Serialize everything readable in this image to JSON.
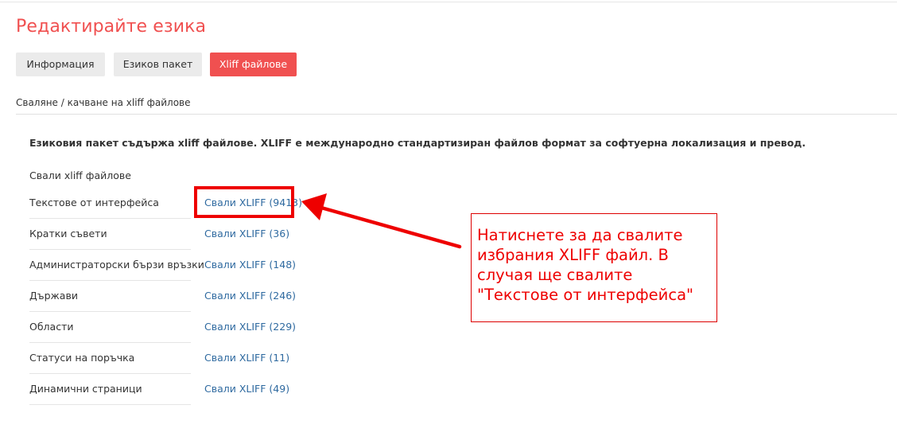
{
  "page": {
    "title": "Редактирайте езика"
  },
  "tabs": [
    {
      "label": "Информация",
      "active": false
    },
    {
      "label": "Езиков пакет",
      "active": false
    },
    {
      "label": "Xliff файлове",
      "active": true
    }
  ],
  "section": {
    "caption": "Сваляне / качване на xliff файлове"
  },
  "intro": "Езиковия пакет съдържа xliff файлове. XLIFF е международно стандартизиран файлов формат за софтуерна локализация и превод.",
  "table": {
    "header": "Свали xliff файлове",
    "rows": [
      {
        "label": "Текстове от интерфейса",
        "link": "Свали XLIFF (9413)"
      },
      {
        "label": "Кратки съвети",
        "link": "Свали XLIFF (36)"
      },
      {
        "label": "Администраторски бързи връзки",
        "link": "Свали XLIFF (148)"
      },
      {
        "label": "Държави",
        "link": "Свали XLIFF (246)"
      },
      {
        "label": "Области",
        "link": "Свали XLIFF (229)"
      },
      {
        "label": "Статуси на поръчка",
        "link": "Свали XLIFF (11)"
      },
      {
        "label": "Динамични страници",
        "link": "Свали XLIFF (49)"
      }
    ]
  },
  "annotation": {
    "lines": [
      "Натиснете за да свалите",
      "избрания XLIFF файл. В",
      "случая ще свалите",
      "\"Текстове от интерфейса\""
    ]
  },
  "colors": {
    "accent": "#f05050",
    "link": "#2f6aa0",
    "annotation": "#ee0000",
    "tab_bg": "#ebebeb"
  }
}
